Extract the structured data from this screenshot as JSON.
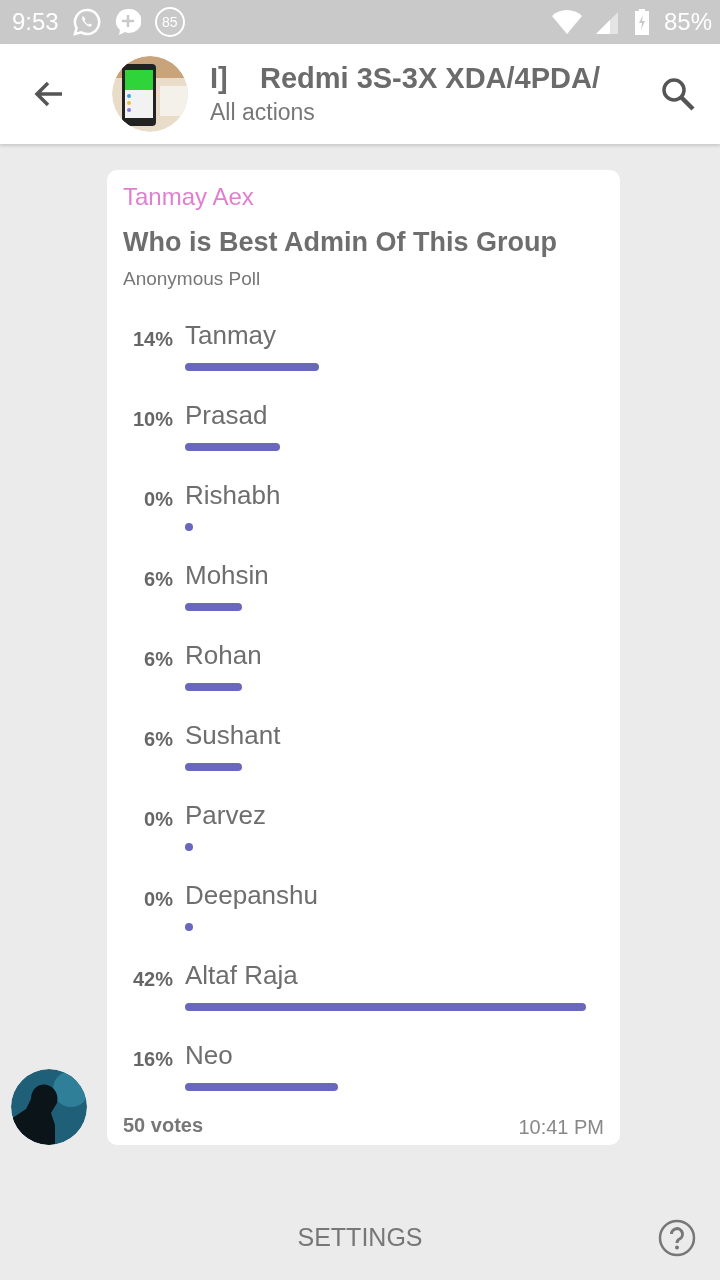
{
  "status_bar": {
    "time": "9:53",
    "notification_count": "85",
    "battery": "85%"
  },
  "header": {
    "title": "I]    Redmi 3S-3X XDA/4PDA/",
    "subtitle": "All actions"
  },
  "poll": {
    "sender": "Tanmay Aex",
    "question": "Who is Best Admin Of This Group",
    "type": "Anonymous Poll",
    "options": [
      {
        "percent": "14%",
        "label": "Tanmay"
      },
      {
        "percent": "10%",
        "label": "Prasad"
      },
      {
        "percent": "0%",
        "label": "Rishabh"
      },
      {
        "percent": "6%",
        "label": "Mohsin"
      },
      {
        "percent": "6%",
        "label": "Rohan"
      },
      {
        "percent": "6%",
        "label": "Sushant"
      },
      {
        "percent": "0%",
        "label": "Parvez"
      },
      {
        "percent": "0%",
        "label": "Deepanshu"
      },
      {
        "percent": "42%",
        "label": "Altaf Raja"
      },
      {
        "percent": "16%",
        "label": "Neo"
      }
    ],
    "votes": "50 votes",
    "time": "10:41 PM"
  },
  "bottom_bar": {
    "button": "SETTINGS"
  }
}
